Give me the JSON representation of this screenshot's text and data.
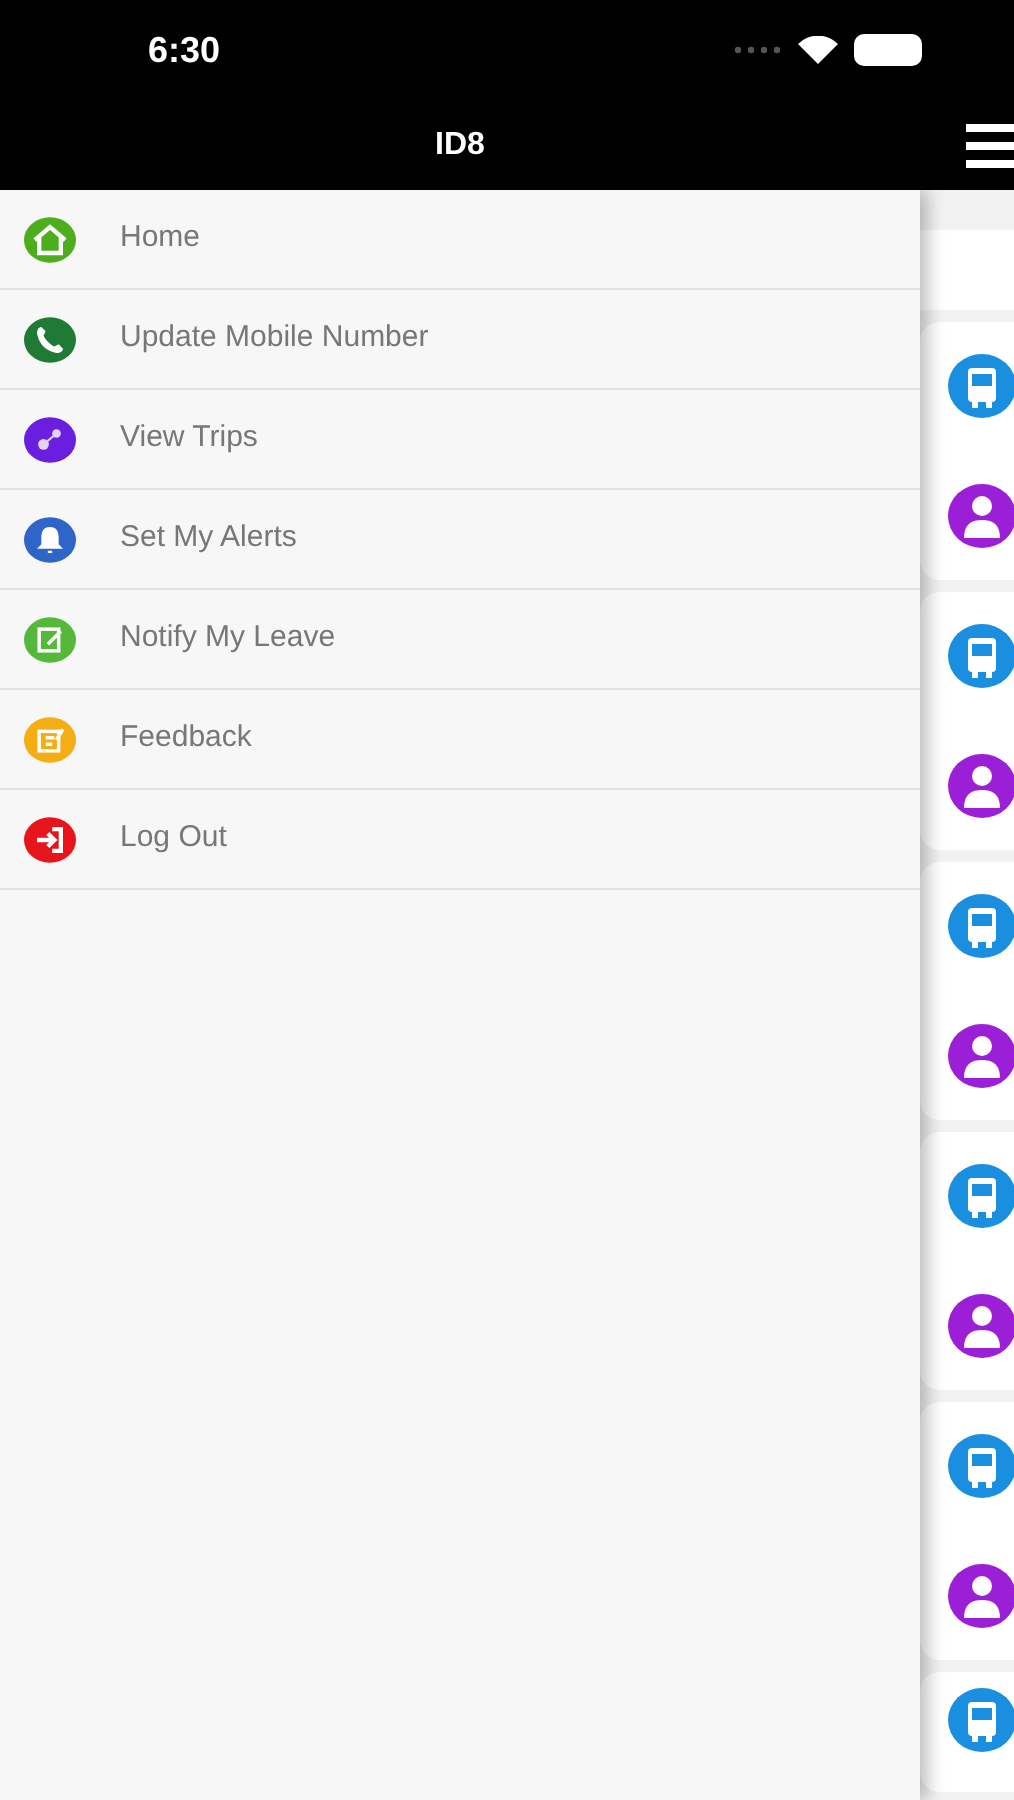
{
  "status_bar": {
    "time": "6:30"
  },
  "nav_bar": {
    "title": "ID8"
  },
  "menu": [
    {
      "label": "Home",
      "kind": "home",
      "color": "#4cae1c"
    },
    {
      "label": "Update Mobile Number",
      "kind": "phone",
      "color": "#1e7a34"
    },
    {
      "label": "View Trips",
      "kind": "trips",
      "color": "#6a1fe0"
    },
    {
      "label": "Set My Alerts",
      "kind": "bell",
      "color": "#2f64c8"
    },
    {
      "label": "Notify My Leave",
      "kind": "edit",
      "color": "#56b83a"
    },
    {
      "label": "Feedback",
      "kind": "feedback",
      "color": "#f5ad14"
    },
    {
      "label": "Log Out",
      "kind": "logout",
      "color": "#e8141c"
    }
  ]
}
